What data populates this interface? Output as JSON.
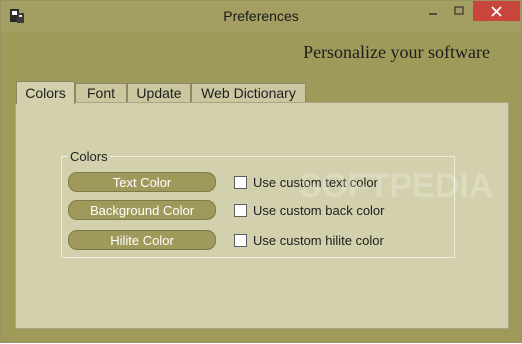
{
  "window": {
    "title": "Preferences"
  },
  "header": {
    "headline": "Personalize your software"
  },
  "tabs": [
    {
      "label": "Colors",
      "active": true
    },
    {
      "label": "Font"
    },
    {
      "label": "Update"
    },
    {
      "label": "Web Dictionary"
    }
  ],
  "colors_group": {
    "label": "Colors",
    "buttons": [
      {
        "label": "Text Color"
      },
      {
        "label": "Background Color"
      },
      {
        "label": "Hilite Color"
      }
    ],
    "checkboxes": [
      {
        "label": "Use custom text color",
        "checked": false
      },
      {
        "label": "Use custom back color",
        "checked": false
      },
      {
        "label": "Use custom hilite color",
        "checked": false
      }
    ]
  },
  "watermark": "SOFTPEDIA",
  "theme": {
    "frame": "#9f9a5a",
    "panel": "#d3d0ad",
    "button": "#9f9a5c",
    "close": "#c7453b"
  }
}
